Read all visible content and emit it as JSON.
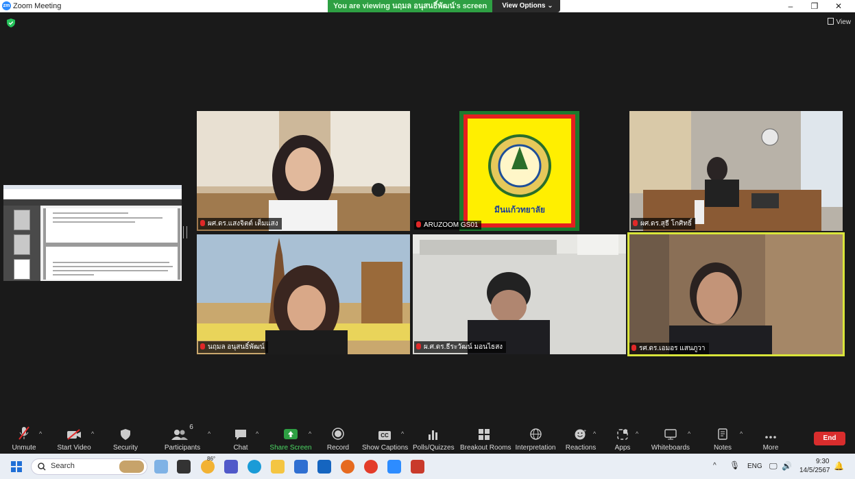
{
  "window": {
    "title": "Zoom Meeting",
    "app_icon": "zm",
    "banner_text": "You are viewing นฤมล อนุสนธิ์พัฒน์'s screen",
    "view_options_label": "View Options",
    "view_label": "View"
  },
  "tiles": [
    {
      "name": "ผศ.ดร.แสงจิตต์  เต็มแสง",
      "active": false
    },
    {
      "name": "ARUZOOM GS01",
      "active": false,
      "logo_text": "มีนแก้วทยาลัย"
    },
    {
      "name": "ผศ.ดร.สุธี  โกศิทธิ์",
      "active": false
    },
    {
      "name": "นฤมล อนุสนธิ์พัฒน์",
      "active": false
    },
    {
      "name": "ผ.ศ.ดร.ธีระวัฒน์ มอนไธสง",
      "active": false
    },
    {
      "name": "รศ.ดร.เอมอร  แสนภูวา",
      "active": true
    }
  ],
  "toolbar": {
    "unmute": "Unmute",
    "start_video": "Start Video",
    "security": "Security",
    "participants": "Participants",
    "participants_count": "6",
    "chat": "Chat",
    "share_screen": "Share Screen",
    "record": "Record",
    "show_captions": "Show Captions",
    "cc": "CC",
    "polls": "Polls/Quizzes",
    "breakout": "Breakout Rooms",
    "interpretation": "Interpretation",
    "reactions": "Reactions",
    "apps": "Apps",
    "whiteboards": "Whiteboards",
    "notes": "Notes",
    "more": "More",
    "end": "End"
  },
  "taskbar": {
    "search_placeholder": "Search",
    "weather_temp": "86°",
    "language": "ENG",
    "time": "9:30",
    "date": "14/5/2567"
  },
  "colors": {
    "zoom_blue": "#2d8cff",
    "banner_green": "#2ea043",
    "end_red": "#d92d2d",
    "active_speaker": "#d9e53a"
  }
}
